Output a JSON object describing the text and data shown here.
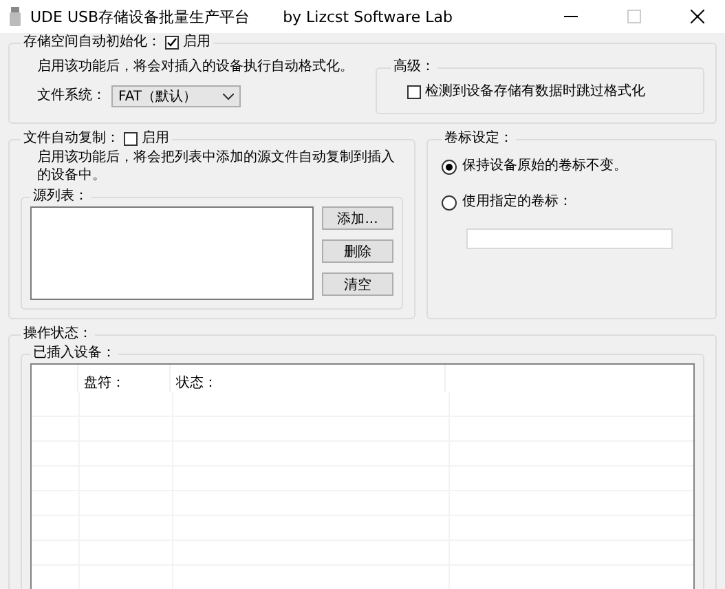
{
  "window": {
    "title": "UDE USB存储设备批量生产平台",
    "subtitle": "by Lizcst Software Lab",
    "controls": [
      {
        "kind": "minimize",
        "disabled": false
      },
      {
        "kind": "maximize",
        "disabled": true
      },
      {
        "kind": "close",
        "disabled": false
      }
    ]
  },
  "auto_format": {
    "label": "存储空间自动初始化：",
    "checkbox": {
      "label": "启用",
      "checked": true
    },
    "description": "启用该功能后，将会对插入的设备执行自动格式化。",
    "file_system": {
      "label": "文件系统：",
      "value": "FAT（默认）"
    }
  },
  "advanced": {
    "title": "高级：",
    "skip_checkbox": {
      "label": "检测到设备存储有数据时跳过格式化",
      "checked": false
    }
  },
  "auto_copy": {
    "label": "文件自动复制：",
    "checkbox": {
      "label": "启用",
      "checked": false
    },
    "description": "启用该功能后，将会把列表中添加的源文件自动复制到插入的设备中。",
    "source_list": {
      "title": "源列表："
    },
    "buttons": [
      "添加...",
      "删除",
      "清空"
    ]
  },
  "volume_label": {
    "title": "卷标设定：",
    "options": [
      {
        "label": "保持设备原始的卷标不变。",
        "selected": true
      },
      {
        "label": "使用指定的卷标：",
        "selected": false
      }
    ]
  },
  "status": {
    "title": "操作状态：",
    "devices": {
      "title": "已插入设备：",
      "columns": [
        {
          "label": "盘符："
        },
        {
          "label": "状态："
        }
      ]
    }
  }
}
